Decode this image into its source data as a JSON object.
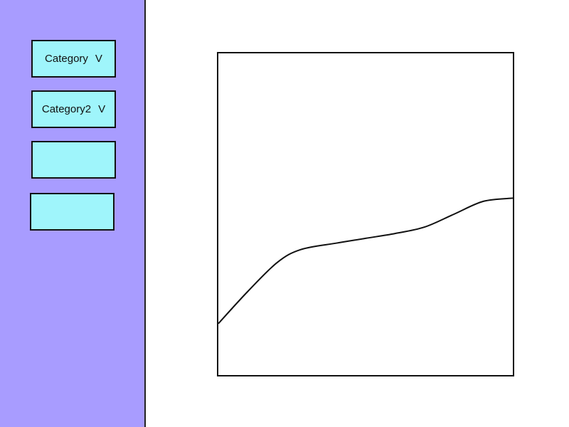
{
  "sidebar": {
    "dropdown_1": {
      "label": "Category",
      "chevron": "V"
    },
    "dropdown_2": {
      "label": "Category2",
      "chevron": "V"
    },
    "empty_field_1": "",
    "empty_field_2": ""
  },
  "colors": {
    "sidebar_bg": "#a89cff",
    "control_bg": "#9ff5fb",
    "line": "#111111"
  },
  "chart_data": {
    "type": "line",
    "title": "",
    "xlabel": "",
    "ylabel": "",
    "xlim": [
      0,
      10
    ],
    "ylim": [
      0,
      10
    ],
    "grid": false,
    "series": [
      {
        "x": [
          0,
          1,
          2,
          2.8,
          4,
          5,
          6,
          7,
          8,
          9,
          10
        ],
        "y": [
          1.6,
          2.6,
          3.5,
          3.9,
          4.1,
          4.25,
          4.4,
          4.6,
          5.0,
          5.4,
          5.5
        ]
      }
    ]
  }
}
